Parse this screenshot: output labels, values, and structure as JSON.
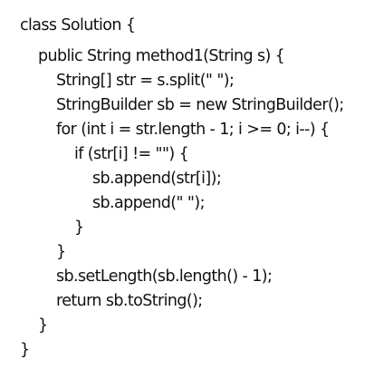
{
  "code": {
    "lines": [
      "class Solution {",
      "public String method1(String s) {",
      "String[] str = s.split(\" \");",
      "StringBuilder sb = new StringBuilder();",
      "for (int i = str.length - 1; i >= 0; i--) {",
      "if (str[i] != \"\") {",
      "sb.append(str[i]);",
      "sb.append(\" \");",
      "}",
      "}",
      "sb.setLength(sb.length() - 1);",
      "return sb.toString();",
      "}",
      "}"
    ]
  }
}
